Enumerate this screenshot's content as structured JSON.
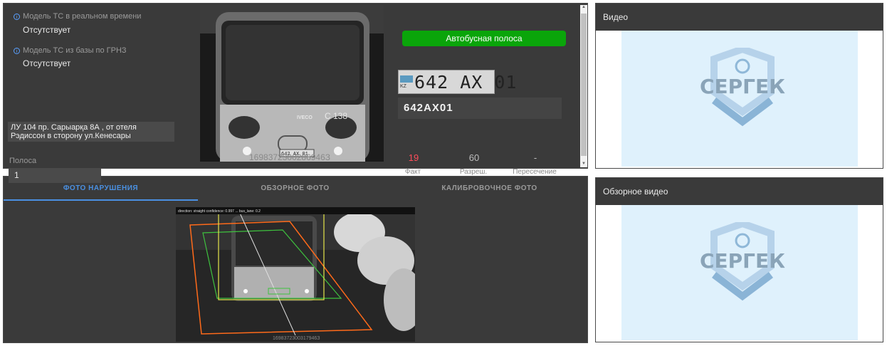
{
  "info": {
    "realtime_model_label": "Модель ТС в реальном времени",
    "realtime_model_value": "Отсутствует",
    "db_model_label": "Модель ТС из базы по ГРНЗ",
    "db_model_value": "Отсутствует",
    "location": "ЛУ 104 пр. Сарыарқа 8А , от отеля Рэдиссон в сторону ул.Кенесары",
    "lane_label": "Полоса",
    "lane_value": "1"
  },
  "bus_photo": {
    "bus_number": "C 138",
    "bus_brand": "IVECO",
    "timestamp": "1698372300286946З"
  },
  "violation": {
    "type": "Автобусная полоса",
    "plate_region": "KZ",
    "plate_image_text": "642 AX 01",
    "plate_recognized": "642AX01"
  },
  "stats": [
    {
      "value": "19",
      "label": "Факт",
      "color": "#ff4d5a"
    },
    {
      "value": "60",
      "label": "Разреш.",
      "color": "#bdbdbd"
    },
    {
      "value": "-",
      "label": "Пересечение",
      "color": "#bdbdbd"
    }
  ],
  "tabs": {
    "violation_photo": "ФОТО НАРУШЕНИЯ",
    "overview_photo": "ОБЗОРНОЕ ФОТО",
    "calibration_photo": "КАЛИБРОВОЧНОЕ ФОТО"
  },
  "violation_photo": {
    "timestamp": "1698372300317946З",
    "overlay_text": "direction: straight   confidence: 0.997   ...   bus_lane: 0.2"
  },
  "video_panel": {
    "title": "Видео"
  },
  "overview_video_panel": {
    "title": "Обзорное видео"
  },
  "brand_logo_text": "СЕРГЕК",
  "colors": {
    "accent_blue": "#4a90e2",
    "violation_green": "#0aa50a",
    "fact_red": "#ff4d5a",
    "panel_bg": "#3a3a3a",
    "logo_blue": "#8fb8d8"
  }
}
